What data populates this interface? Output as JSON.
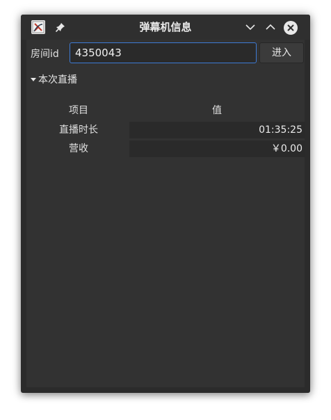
{
  "window": {
    "title": "弹幕机信息"
  },
  "titlebar": {
    "icons": [
      "app-icon",
      "pin-icon",
      "minimize-chevron-down-icon",
      "maximize-chevron-up-icon",
      "close-icon"
    ]
  },
  "room": {
    "label": "房间id",
    "value": "4350043",
    "enter_label": "进入"
  },
  "section": {
    "header": "本次直播",
    "col_item": "项目",
    "col_value": "值",
    "rows": [
      {
        "label": "直播时长",
        "value": "01:35:25"
      },
      {
        "label": "营收",
        "value": "￥0.00"
      }
    ]
  },
  "colors": {
    "window_bg": "#2b2b2b",
    "content_bg": "#323232",
    "input_border": "#3d7bd6",
    "text": "#e0e0e0"
  }
}
